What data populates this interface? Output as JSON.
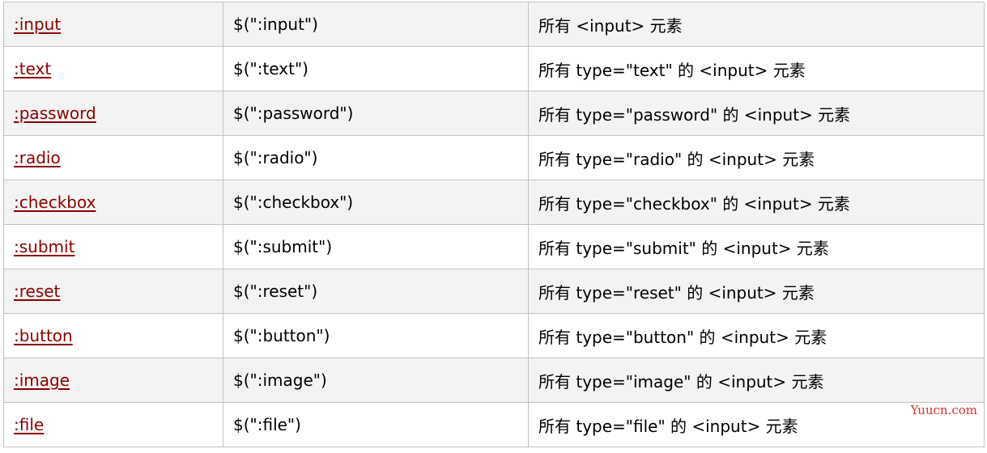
{
  "rows": [
    {
      "selector": ":input",
      "example": "$(\":input\")",
      "description": "所有 <input> 元素"
    },
    {
      "selector": ":text",
      "example": "$(\":text\")",
      "description": "所有 type=\"text\" 的 <input> 元素"
    },
    {
      "selector": ":password",
      "example": "$(\":password\")",
      "description": "所有 type=\"password\" 的 <input> 元素"
    },
    {
      "selector": ":radio",
      "example": "$(\":radio\")",
      "description": "所有 type=\"radio\" 的 <input> 元素"
    },
    {
      "selector": ":checkbox",
      "example": "$(\":checkbox\")",
      "description": "所有 type=\"checkbox\" 的 <input> 元素"
    },
    {
      "selector": ":submit",
      "example": "$(\":submit\")",
      "description": "所有 type=\"submit\" 的 <input> 元素"
    },
    {
      "selector": ":reset",
      "example": "$(\":reset\")",
      "description": "所有 type=\"reset\" 的 <input> 元素"
    },
    {
      "selector": ":button",
      "example": "$(\":button\")",
      "description": "所有 type=\"button\" 的 <input> 元素"
    },
    {
      "selector": ":image",
      "example": "$(\":image\")",
      "description": "所有 type=\"image\" 的 <input> 元素"
    },
    {
      "selector": ":file",
      "example": "$(\":file\")",
      "description": "所有 type=\"file\" 的 <input> 元素"
    }
  ],
  "watermark": "Yuucn.com",
  "colors": {
    "link": "#8b0000",
    "row_alt": "#f3f3f3",
    "border": "#c3c3c3",
    "watermark": "#cc3333"
  }
}
